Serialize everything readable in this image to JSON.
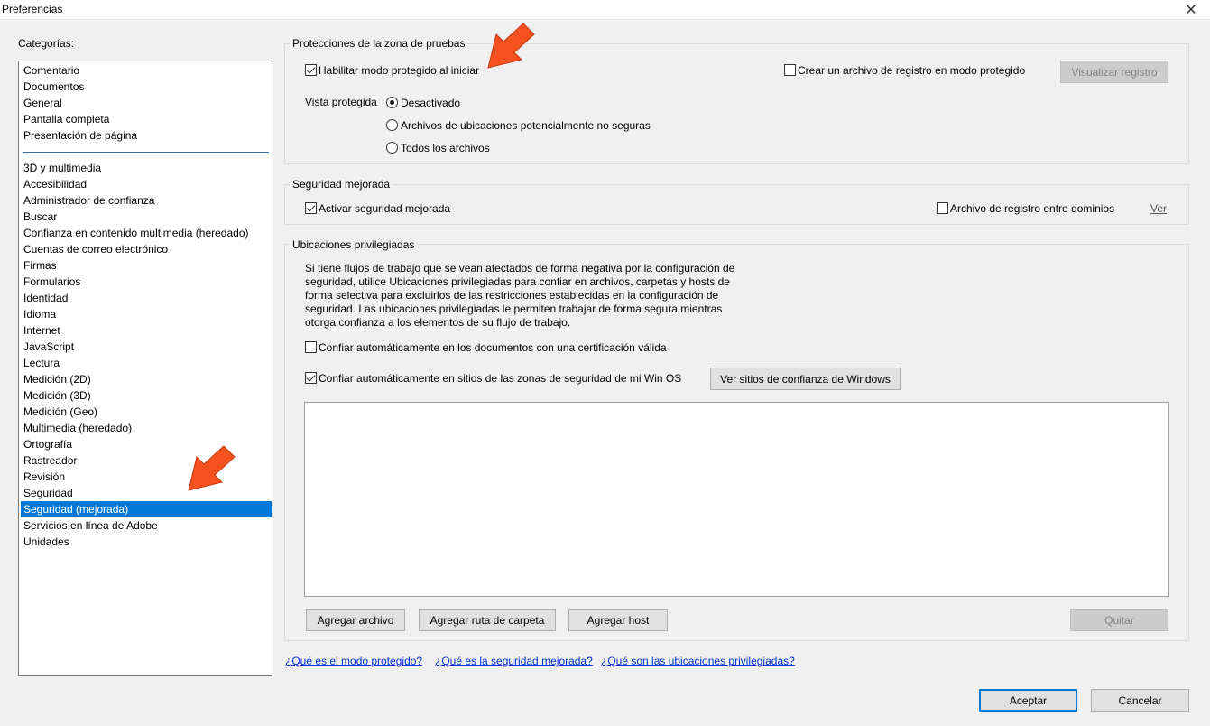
{
  "window": {
    "title": "Preferencias",
    "close_glyph": "✕"
  },
  "sidebar": {
    "label": "Categorías:",
    "group1": [
      "Comentario",
      "Documentos",
      "General",
      "Pantalla completa",
      "Presentación de página"
    ],
    "group2": [
      "3D y multimedia",
      "Accesibilidad",
      "Administrador de confianza",
      "Buscar",
      "Confianza en contenido multimedia (heredado)",
      "Cuentas de correo electrónico",
      "Firmas",
      "Formularios",
      "Identidad",
      "Idioma",
      "Internet",
      "JavaScript",
      "Lectura",
      "Medición (2D)",
      "Medición (3D)",
      "Medición (Geo)",
      "Multimedia (heredado)",
      "Ortografía",
      "Rastreador",
      "Revisión",
      "Seguridad",
      "Seguridad (mejorada)",
      "Servicios en línea de Adobe",
      "Unidades"
    ],
    "selected": "Seguridad (mejorada)"
  },
  "sandbox": {
    "title": "Protecciones de la zona de pruebas",
    "enable_protected": {
      "label": "Habilitar modo protegido al iniciar",
      "checked": true
    },
    "create_log": {
      "label": "Crear un archivo de registro en modo protegido",
      "checked": false
    },
    "view_log_button": "Visualizar registro",
    "protected_view_label": "Vista protegida",
    "radio_options": [
      "Desactivado",
      "Archivos de ubicaciones potencialmente no seguras",
      "Todos los archivos"
    ],
    "radio_selected": 0
  },
  "enhanced": {
    "title": "Seguridad mejorada",
    "enable": {
      "label": "Activar seguridad mejorada",
      "checked": true
    },
    "cross_domain": {
      "label": "Archivo de registro entre dominios",
      "checked": false
    },
    "view_link": "Ver"
  },
  "privileged": {
    "title": "Ubicaciones privilegiadas",
    "description": "Si tiene flujos de trabajo que se vean afectados de forma negativa por la configuración de seguridad, utilice Ubicaciones privilegiadas para confiar en archivos, carpetas y hosts de forma selectiva para excluirlos de las restricciones establecidas en la configuración de seguridad. Las ubicaciones privilegiadas le permiten trabajar de forma segura mientras otorga confianza a los elementos de su flujo de trabajo.",
    "trust_certified": {
      "label": "Confiar automáticamente en los documentos con una certificación válida",
      "checked": false
    },
    "trust_os_zones": {
      "label": "Confiar automáticamente en sitios de las zonas de seguridad de mi Win OS",
      "checked": true
    },
    "view_windows_sites": "Ver sitios de confianza de Windows",
    "add_file": "Agregar archivo",
    "add_folder": "Agregar ruta de carpeta",
    "add_host": "Agregar host",
    "remove": "Quitar"
  },
  "help_links": [
    "¿Qué es el modo protegido?",
    "¿Qué es la seguridad mejorada?",
    "¿Qué son las ubicaciones privilegiadas?"
  ],
  "footer": {
    "ok": "Aceptar",
    "cancel": "Cancelar"
  },
  "colors": {
    "selection": "#0078d7",
    "arrow": "#f4511e",
    "link": "#0033cc"
  }
}
